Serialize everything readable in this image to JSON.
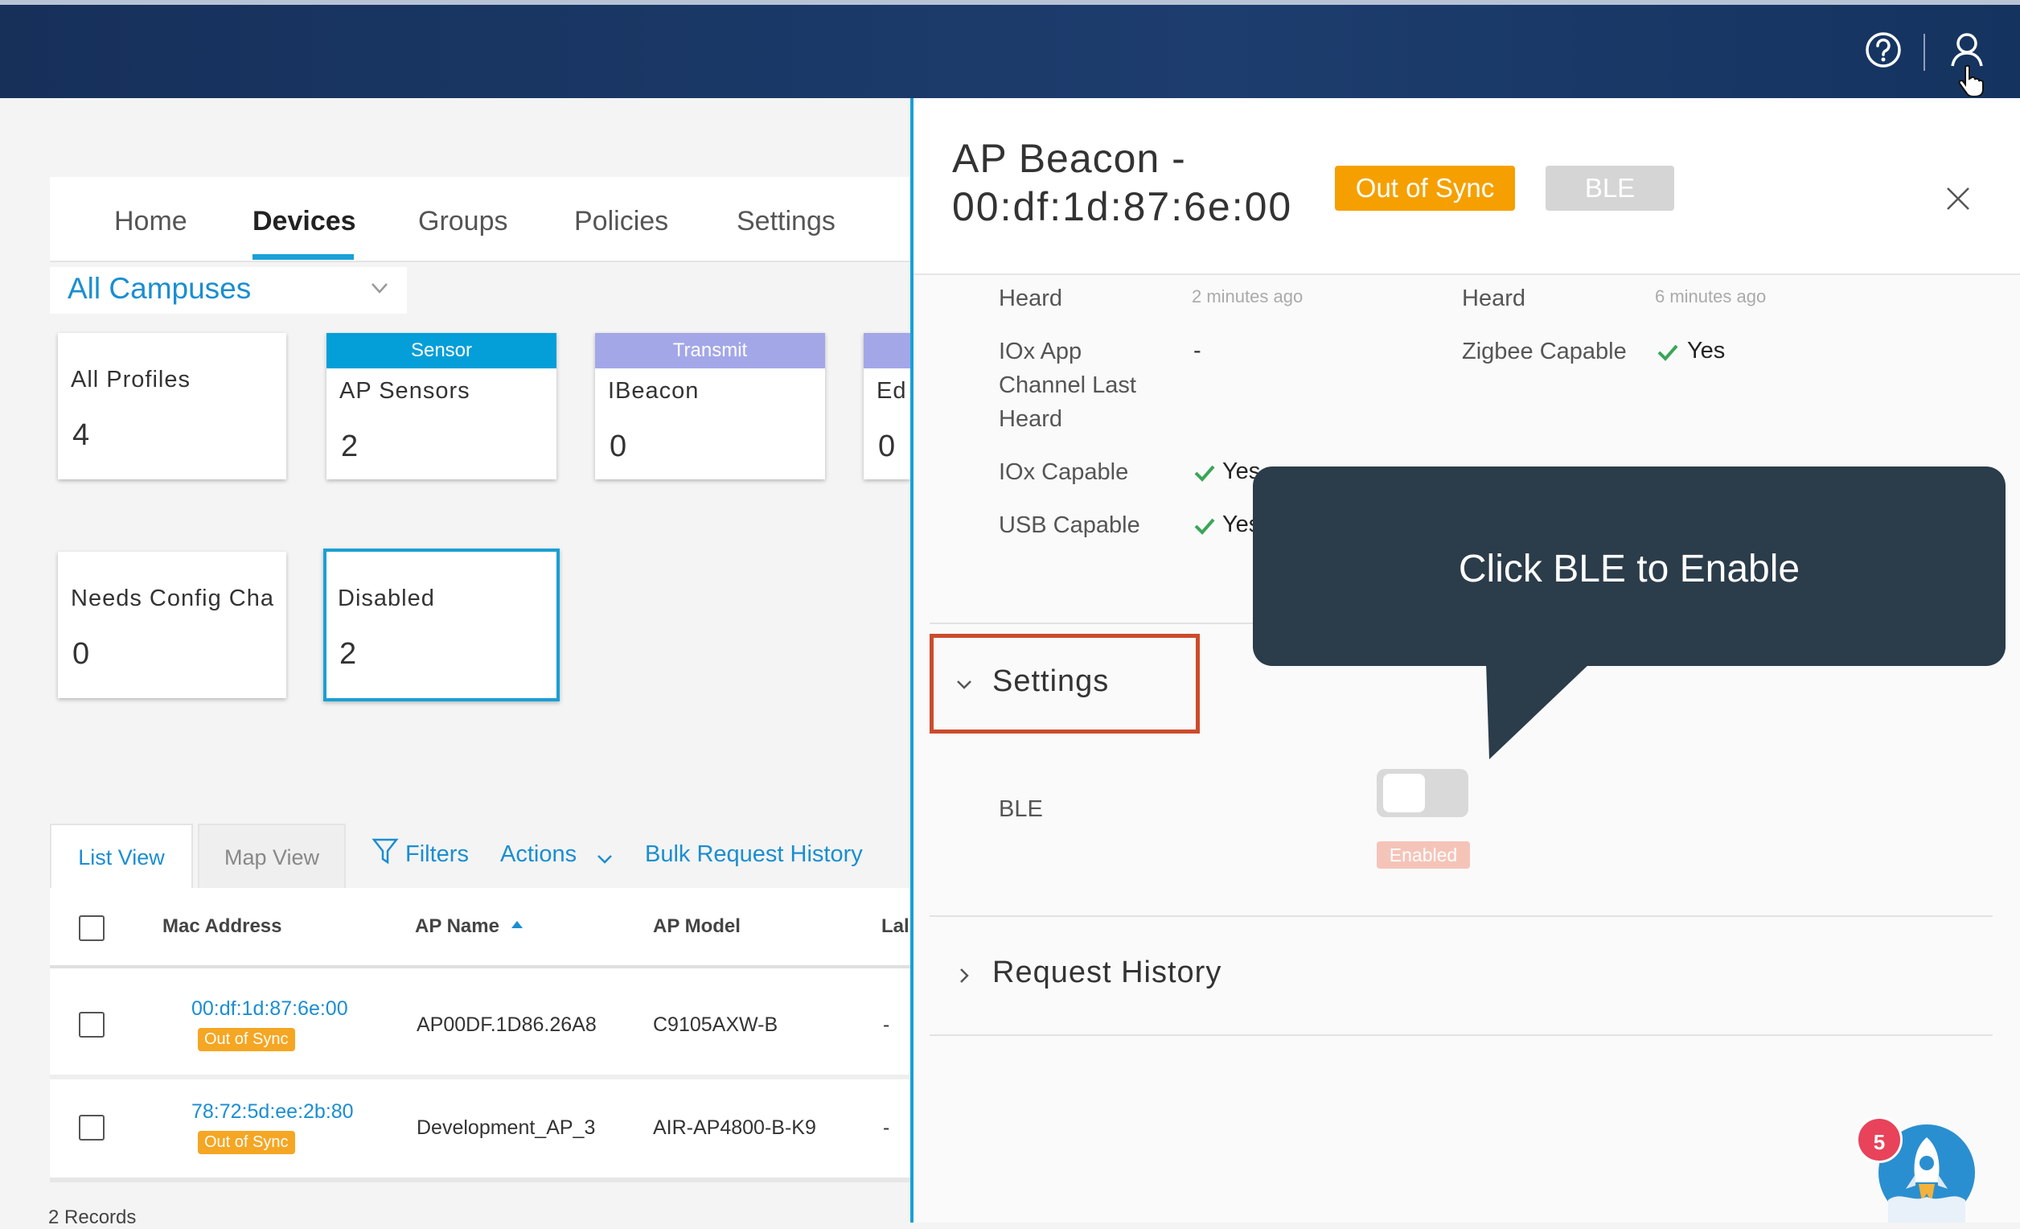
{
  "header": {
    "help_icon": "question-circle-icon",
    "user_icon": "user-icon"
  },
  "nav": {
    "tabs": [
      "Home",
      "Devices",
      "Groups",
      "Policies",
      "Settings"
    ],
    "active_tab": "Devices"
  },
  "campus_selector": {
    "value": "All Campuses"
  },
  "profile_cards": [
    {
      "header": "",
      "label": "All Profiles",
      "count": "4"
    },
    {
      "header": "Sensor",
      "label": "AP Sensors",
      "count": "2",
      "header_color": "#049fd9"
    },
    {
      "header": "Transmit",
      "label": "IBeacon",
      "count": "0",
      "header_color": "#a3a7e8"
    },
    {
      "header": "",
      "label": "Ed",
      "count": "0"
    },
    {
      "header": "",
      "label": "Needs Config Cha",
      "count": "0"
    },
    {
      "header": "",
      "label": "Disabled",
      "count": "2",
      "selected": true
    }
  ],
  "view_tabs": [
    "List View",
    "Map View"
  ],
  "toolbar": {
    "filters": "Filters",
    "actions": "Actions",
    "bulk_history": "Bulk Request History"
  },
  "table": {
    "columns": [
      "Mac Address",
      "AP Name",
      "AP Model",
      "Lal"
    ],
    "rows": [
      {
        "mac": "00:df:1d:87:6e:00",
        "status": "Out of Sync",
        "ap_name": "AP00DF.1D86.26A8",
        "ap_model": "C9105AXW-B",
        "label": "-"
      },
      {
        "mac": "78:72:5d:ee:2b:80",
        "status": "Out of Sync",
        "ap_name": "Development_AP_3",
        "ap_model": "AIR-AP4800-B-K9",
        "label": "-"
      }
    ],
    "records": "2 Records"
  },
  "panel": {
    "title_line1": "AP Beacon -",
    "title_line2": "00:df:1d:87:6e:00",
    "badge_status": "Out of Sync",
    "badge_ble": "BLE",
    "details": {
      "heard_label_left": "Heard",
      "heard_value_left": "2 minutes ago",
      "heard_label_right": "Heard",
      "heard_value_right": "6 minutes ago",
      "iox_channel_label": [
        "IOx App",
        "Channel Last",
        "Heard"
      ],
      "iox_channel_value": "-",
      "zigbee_label": "Zigbee Capable",
      "zigbee_value": "Yes",
      "iox_capable_label": "IOx Capable",
      "iox_capable_value": "Yes",
      "usb_capable_label": "USB Capable",
      "usb_capable_value": "Yes"
    },
    "settings_title": "Settings",
    "ble_label": "BLE",
    "ble_toggle_on": false,
    "ble_badge": "Enabled",
    "request_history_title": "Request History"
  },
  "callout": {
    "text": "Click BLE to Enable"
  },
  "widget": {
    "notification_count": "5"
  },
  "colors": {
    "accent": "#1a8ed1",
    "out_of_sync": "#f5a000",
    "highlight_box": "#cc4b2b",
    "callout_bg": "#2b3c4a"
  }
}
